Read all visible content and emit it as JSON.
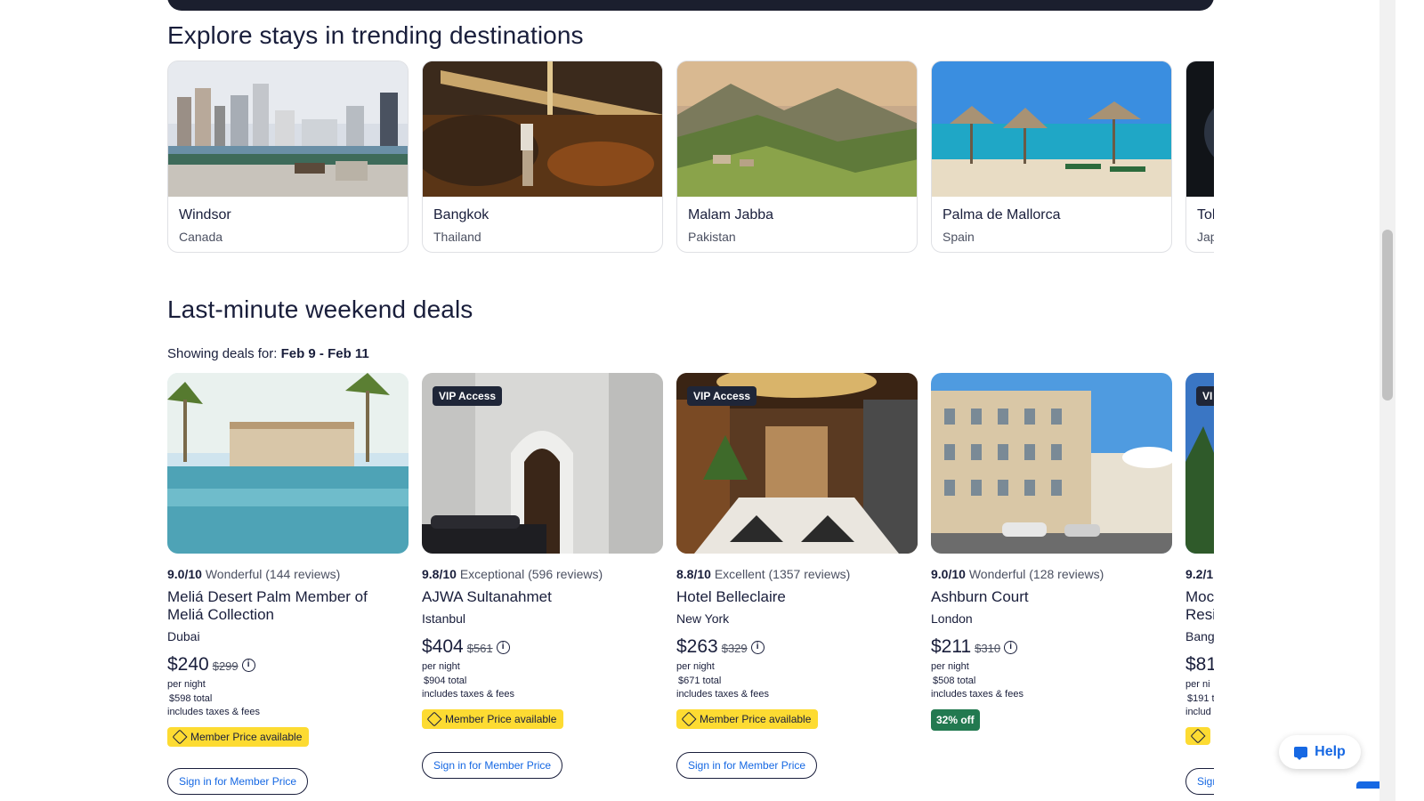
{
  "trending": {
    "title": "Explore stays in trending destinations",
    "destinations": [
      {
        "name": "Windsor",
        "country": "Canada"
      },
      {
        "name": "Bangkok",
        "country": "Thailand"
      },
      {
        "name": "Malam Jabba",
        "country": "Pakistan"
      },
      {
        "name": "Palma de Mallorca",
        "country": "Spain"
      },
      {
        "name": "Tol",
        "country": "Jap"
      }
    ]
  },
  "deals": {
    "title": "Last-minute weekend deals",
    "showing_label": "Showing deals for:",
    "date_range": "Feb 9 - Feb 11",
    "hotels": [
      {
        "rating": "9.0/10",
        "rating_word": "Wonderful (144 reviews)",
        "name": "Meliá Desert Palm Member of Meliá Collection",
        "city": "Dubai",
        "price": "$240",
        "old_price": "$299",
        "per_night": "per night",
        "total": "$598 total",
        "taxes": "includes taxes & fees",
        "badge": "Member Price available",
        "button": "Sign in for Member Price",
        "vip": ""
      },
      {
        "rating": "9.8/10",
        "rating_word": "Exceptional (596 reviews)",
        "name": "AJWA Sultanahmet",
        "city": "Istanbul",
        "price": "$404",
        "old_price": "$561",
        "per_night": "per night",
        "total": "$904 total",
        "taxes": "includes taxes & fees",
        "badge": "Member Price available",
        "button": "Sign in for Member Price",
        "vip": "VIP Access"
      },
      {
        "rating": "8.8/10",
        "rating_word": "Excellent (1357 reviews)",
        "name": "Hotel Belleclaire",
        "city": "New York",
        "price": "$263",
        "old_price": "$329",
        "per_night": "per night",
        "total": "$671 total",
        "taxes": "includes taxes & fees",
        "badge": "Member Price available",
        "button": "Sign in for Member Price",
        "vip": "VIP Access"
      },
      {
        "rating": "9.0/10",
        "rating_word": "Wonderful (128 reviews)",
        "name": "Ashburn Court",
        "city": "London",
        "price": "$211",
        "old_price": "$310",
        "per_night": "per night",
        "total": "$508 total",
        "taxes": "includes taxes & fees",
        "discount": "32% off",
        "vip": ""
      },
      {
        "rating": "9.2/1",
        "name": "Moc",
        "name2": "Resi",
        "city": "Bang",
        "price": "$81",
        "per_night": "per ni",
        "total": "$191 to",
        "taxes": "includ",
        "button": "Sign",
        "vip": "VI"
      }
    ]
  },
  "help": {
    "label": "Help"
  },
  "colors": {
    "navy": "#191e3b",
    "link_blue": "#1668e3",
    "member_yellow": "#fddb32",
    "discount_green": "#227950",
    "vip_dark": "#1f2638"
  }
}
